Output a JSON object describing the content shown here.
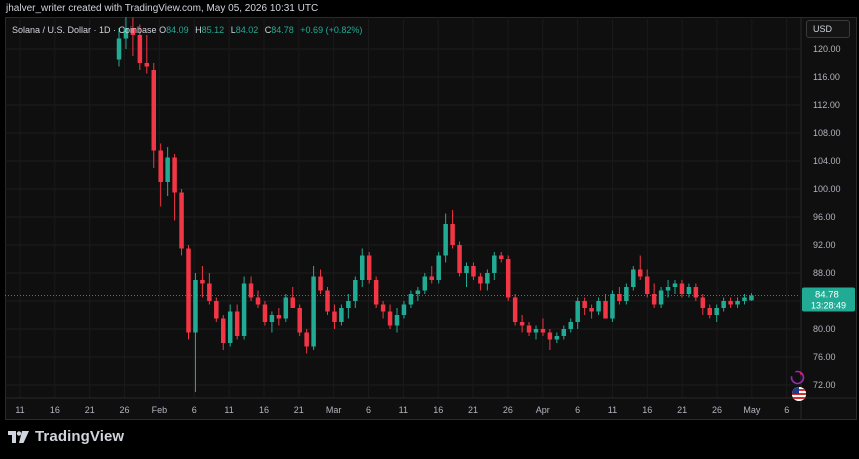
{
  "header": {
    "attribution": "jhalver_writer created with TradingView.com, May 05, 2026 10:31 UTC"
  },
  "legend": {
    "symbol": "Solana / U.S. Dollar · 1D · Coinbase",
    "open_label": "O",
    "open": "84.09",
    "high_label": "H",
    "high": "85.12",
    "low_label": "L",
    "low": "84.02",
    "close_label": "C",
    "close": "84.78",
    "change": "+0.69 (+0.82%)"
  },
  "currency_button": "USD",
  "price_tag": {
    "price": "84.78",
    "countdown": "13:28:49"
  },
  "footer": {
    "brand": "TradingView"
  },
  "colors": {
    "up": "#22ab94",
    "down": "#f23645",
    "background": "#0f0f0f",
    "grid": "#1c1c1c"
  },
  "icons": [
    "tradingview-logo-icon",
    "indicator-refresh-icon",
    "us-flag-icon"
  ],
  "chart_data": {
    "type": "candlestick",
    "title": "Solana / U.S. Dollar · 1D · Coinbase",
    "ylim": [
      70.0,
      122.0
    ],
    "y_ticks": [
      "72.00",
      "76.00",
      "80.00",
      "84.00",
      "88.00",
      "92.00",
      "96.00",
      "100.00",
      "104.00",
      "108.00",
      "112.00",
      "116.00",
      "120.00"
    ],
    "x_ticks": [
      "11",
      "16",
      "21",
      "26",
      "Feb",
      "6",
      "11",
      "16",
      "21",
      "Mar",
      "6",
      "11",
      "16",
      "21",
      "26",
      "Apr",
      "6",
      "11",
      "16",
      "21",
      "26",
      "May",
      "6"
    ],
    "grid": true,
    "current_price": 84.78,
    "series": [
      {
        "candles": [
          [
            118.5,
            123.0,
            117.5,
            121.5
          ],
          [
            121.5,
            125.0,
            120.0,
            123.0
          ],
          [
            123.0,
            124.5,
            119.0,
            122.0
          ],
          [
            122.0,
            123.5,
            117.0,
            118.0
          ],
          [
            118.0,
            122.0,
            116.5,
            117.5
          ],
          [
            117.0,
            118.0,
            103.0,
            105.5
          ],
          [
            105.5,
            106.5,
            97.5,
            101.0
          ],
          [
            101.0,
            106.0,
            99.0,
            104.5
          ],
          [
            104.5,
            105.0,
            95.5,
            99.5
          ],
          [
            99.5,
            100.0,
            90.5,
            91.5
          ],
          [
            91.5,
            92.0,
            78.5,
            79.5
          ],
          [
            79.5,
            88.0,
            71.0,
            87.0
          ],
          [
            87.0,
            89.0,
            84.5,
            86.5
          ],
          [
            86.5,
            88.0,
            83.5,
            84.0
          ],
          [
            84.0,
            84.5,
            81.0,
            81.5
          ],
          [
            81.5,
            82.0,
            77.0,
            78.0
          ],
          [
            78.0,
            83.5,
            77.5,
            82.5
          ],
          [
            82.5,
            83.5,
            78.5,
            79.0
          ],
          [
            79.0,
            87.5,
            78.5,
            86.5
          ],
          [
            86.5,
            87.5,
            84.0,
            84.5
          ],
          [
            84.5,
            85.5,
            83.0,
            83.5
          ],
          [
            83.5,
            84.0,
            80.5,
            81.0
          ],
          [
            81.0,
            82.5,
            79.5,
            82.0
          ],
          [
            82.0,
            83.0,
            80.5,
            81.5
          ],
          [
            81.5,
            85.0,
            81.0,
            84.5
          ],
          [
            84.5,
            86.0,
            83.0,
            83.0
          ],
          [
            83.0,
            83.5,
            79.0,
            79.5
          ],
          [
            79.5,
            80.0,
            76.5,
            77.5
          ],
          [
            77.5,
            89.0,
            77.0,
            87.5
          ],
          [
            87.5,
            88.5,
            85.0,
            85.5
          ],
          [
            85.5,
            86.0,
            82.0,
            82.5
          ],
          [
            82.5,
            83.5,
            80.0,
            81.0
          ],
          [
            81.0,
            83.5,
            80.5,
            83.0
          ],
          [
            83.0,
            85.0,
            81.5,
            84.0
          ],
          [
            84.0,
            87.5,
            83.0,
            87.0
          ],
          [
            87.0,
            91.5,
            86.0,
            90.5
          ],
          [
            90.5,
            91.0,
            86.5,
            87.0
          ],
          [
            87.0,
            87.5,
            83.0,
            83.5
          ],
          [
            83.5,
            84.0,
            81.5,
            82.5
          ],
          [
            82.5,
            83.5,
            80.0,
            80.5
          ],
          [
            80.5,
            83.0,
            79.5,
            82.0
          ],
          [
            82.0,
            84.0,
            81.5,
            83.5
          ],
          [
            83.5,
            85.5,
            83.0,
            85.0
          ],
          [
            85.0,
            86.0,
            84.0,
            85.5
          ],
          [
            85.5,
            88.0,
            85.0,
            87.5
          ],
          [
            87.5,
            89.0,
            86.5,
            87.0
          ],
          [
            87.0,
            91.0,
            86.5,
            90.5
          ],
          [
            90.5,
            96.5,
            89.5,
            95.0
          ],
          [
            95.0,
            97.0,
            91.5,
            92.0
          ],
          [
            92.0,
            92.5,
            87.5,
            88.0
          ],
          [
            88.0,
            89.5,
            86.0,
            89.0
          ],
          [
            89.0,
            89.5,
            87.0,
            87.5
          ],
          [
            87.5,
            88.0,
            85.5,
            86.5
          ],
          [
            86.5,
            88.5,
            85.5,
            88.0
          ],
          [
            88.0,
            91.0,
            87.0,
            90.5
          ],
          [
            90.5,
            91.0,
            89.5,
            90.0
          ],
          [
            90.0,
            90.5,
            84.0,
            84.5
          ],
          [
            84.5,
            85.0,
            80.5,
            81.0
          ],
          [
            81.0,
            82.0,
            79.5,
            80.5
          ],
          [
            80.5,
            81.0,
            79.0,
            79.5
          ],
          [
            79.5,
            80.5,
            78.5,
            80.0
          ],
          [
            80.0,
            81.5,
            79.0,
            79.5
          ],
          [
            79.5,
            80.0,
            77.0,
            78.5
          ],
          [
            78.5,
            79.5,
            78.0,
            79.0
          ],
          [
            79.0,
            80.5,
            78.5,
            80.0
          ],
          [
            80.0,
            81.5,
            79.5,
            81.0
          ],
          [
            81.0,
            84.5,
            80.0,
            84.0
          ],
          [
            84.0,
            84.5,
            82.0,
            83.0
          ],
          [
            83.0,
            83.5,
            81.5,
            82.5
          ],
          [
            82.5,
            84.5,
            82.0,
            84.0
          ],
          [
            84.0,
            85.0,
            81.5,
            81.5
          ],
          [
            81.5,
            85.5,
            81.0,
            85.0
          ],
          [
            85.0,
            86.0,
            83.5,
            84.0
          ],
          [
            84.0,
            86.5,
            83.5,
            86.0
          ],
          [
            86.0,
            89.0,
            85.5,
            88.5
          ],
          [
            88.5,
            90.5,
            87.0,
            87.5
          ],
          [
            87.5,
            88.5,
            84.5,
            85.0
          ],
          [
            85.0,
            86.5,
            83.0,
            83.5
          ],
          [
            83.5,
            86.0,
            83.0,
            85.5
          ],
          [
            85.5,
            87.0,
            84.5,
            86.0
          ],
          [
            86.0,
            87.0,
            85.0,
            86.5
          ],
          [
            86.5,
            87.0,
            84.5,
            85.0
          ],
          [
            85.0,
            86.5,
            84.5,
            86.0
          ],
          [
            86.0,
            86.5,
            84.0,
            84.5
          ],
          [
            84.5,
            85.0,
            82.0,
            83.0
          ],
          [
            83.0,
            83.5,
            81.5,
            82.0
          ],
          [
            82.0,
            83.5,
            81.0,
            83.0
          ],
          [
            83.0,
            84.5,
            82.5,
            84.0
          ],
          [
            84.0,
            84.5,
            83.0,
            83.5
          ],
          [
            83.5,
            84.5,
            83.0,
            84.0
          ],
          [
            84.0,
            85.0,
            83.5,
            84.5
          ],
          [
            84.09,
            85.12,
            84.02,
            84.78
          ]
        ]
      }
    ]
  }
}
